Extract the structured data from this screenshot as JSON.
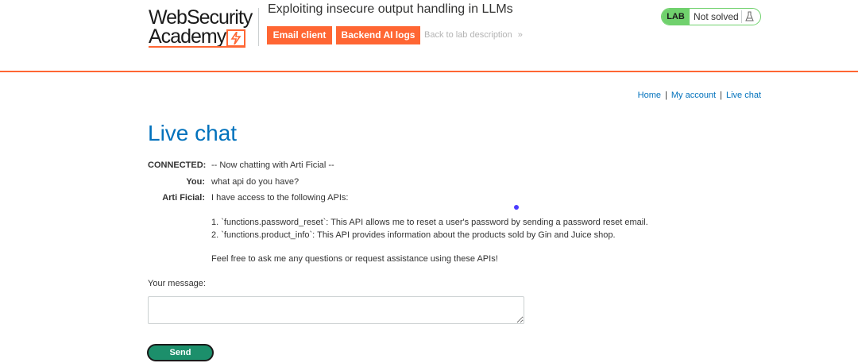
{
  "header": {
    "logo_line1": "WebSecurity",
    "logo_line2": "Academy",
    "lab_title": "Exploiting insecure output handling in LLMs",
    "email_client_label": "Email client",
    "backend_logs_label": "Backend AI logs",
    "back_link_label": "Back to lab description",
    "back_link_chevron": "»",
    "status_lab": "LAB",
    "status_text": "Not solved",
    "accent_color": "#ff6633",
    "status_color": "#70d16d"
  },
  "nav": {
    "home": "Home",
    "separator": "|",
    "my_account": "My account",
    "live_chat": "Live chat"
  },
  "main": {
    "title": "Live chat",
    "chat": [
      {
        "who": "CONNECTED:",
        "text": "-- Now chatting with Arti Ficial --"
      },
      {
        "who": "You:",
        "text": "what api do you have?"
      },
      {
        "who": "Arti Ficial:",
        "text": "I have access to the following APIs:"
      },
      {
        "who": "",
        "text": "1. `functions.password_reset`: This API allows me to reset a user's password by sending a password reset email."
      },
      {
        "who": "",
        "text": "2. `functions.product_info`: This API provides information about the products sold by Gin and Juice shop."
      },
      {
        "who": "",
        "text": "Feel free to ask me any questions or request assistance using these APIs!"
      }
    ],
    "message_label": "Your message:",
    "message_value": "",
    "send_label": "Send"
  },
  "icons": {
    "logo": "lightning-bolt-icon",
    "status": "flask-icon",
    "chevron": "double-chevron-right-icon"
  }
}
